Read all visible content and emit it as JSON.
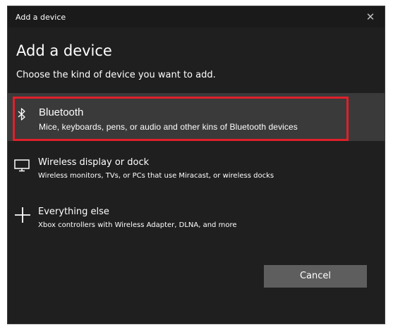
{
  "window": {
    "title": "Add a device",
    "close_glyph": "✕"
  },
  "heading": "Add a device",
  "subtitle": "Choose the kind of device you want to add.",
  "options": [
    {
      "label": "Bluetooth",
      "description": "Mice, keyboards, pens, or audio and other kins of Bluetooth devices",
      "icon": "bluetooth-icon",
      "selected": true
    },
    {
      "label": "Wireless display or dock",
      "description": "Wireless monitors, TVs, or PCs that use Miracast, or wireless docks",
      "icon": "monitor-icon",
      "selected": false
    },
    {
      "label": "Everything else",
      "description": "Xbox controllers with Wireless Adapter, DLNA, and more",
      "icon": "plus-icon",
      "selected": false
    }
  ],
  "buttons": {
    "cancel_label": "Cancel"
  },
  "colors": {
    "background": "#1f1f1f",
    "selected_row": "#3a3a3a",
    "highlight": "#e0202a",
    "button": "#5e5e5e"
  }
}
